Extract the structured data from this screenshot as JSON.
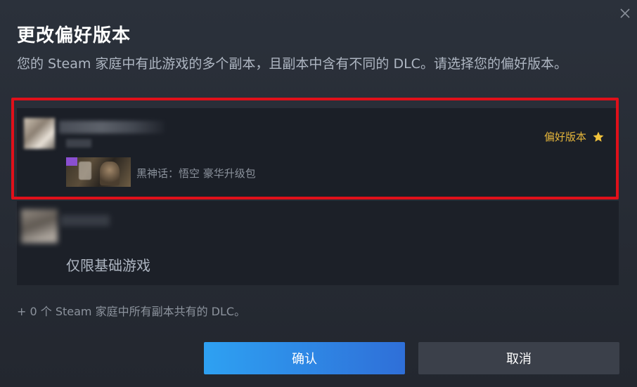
{
  "dialog": {
    "title": "更改偏好版本",
    "description": "您的 Steam 家庭中有此游戏的多个副本，且副本中含有不同的 DLC。请选择您的偏好版本。",
    "close_icon": "close-icon"
  },
  "options": [
    {
      "owner": "",
      "dlc_name": "黑神话：悟空 豪华升级包",
      "preferred_label": "偏好版本",
      "preferred_icon": "star-icon",
      "selected": true
    },
    {
      "owner": "",
      "label": "仅限基础游戏",
      "selected": false
    }
  ],
  "shared_dlc": "+ 0 个 Steam 家庭中所有副本共有的 DLC。",
  "buttons": {
    "confirm_label": "确认",
    "cancel_label": "取消"
  },
  "colors": {
    "accent_gold": "#e4b53b",
    "highlight_red": "#e0101a",
    "confirm_blue": "#2f8ae6",
    "cancel_gray": "#3b404a"
  }
}
